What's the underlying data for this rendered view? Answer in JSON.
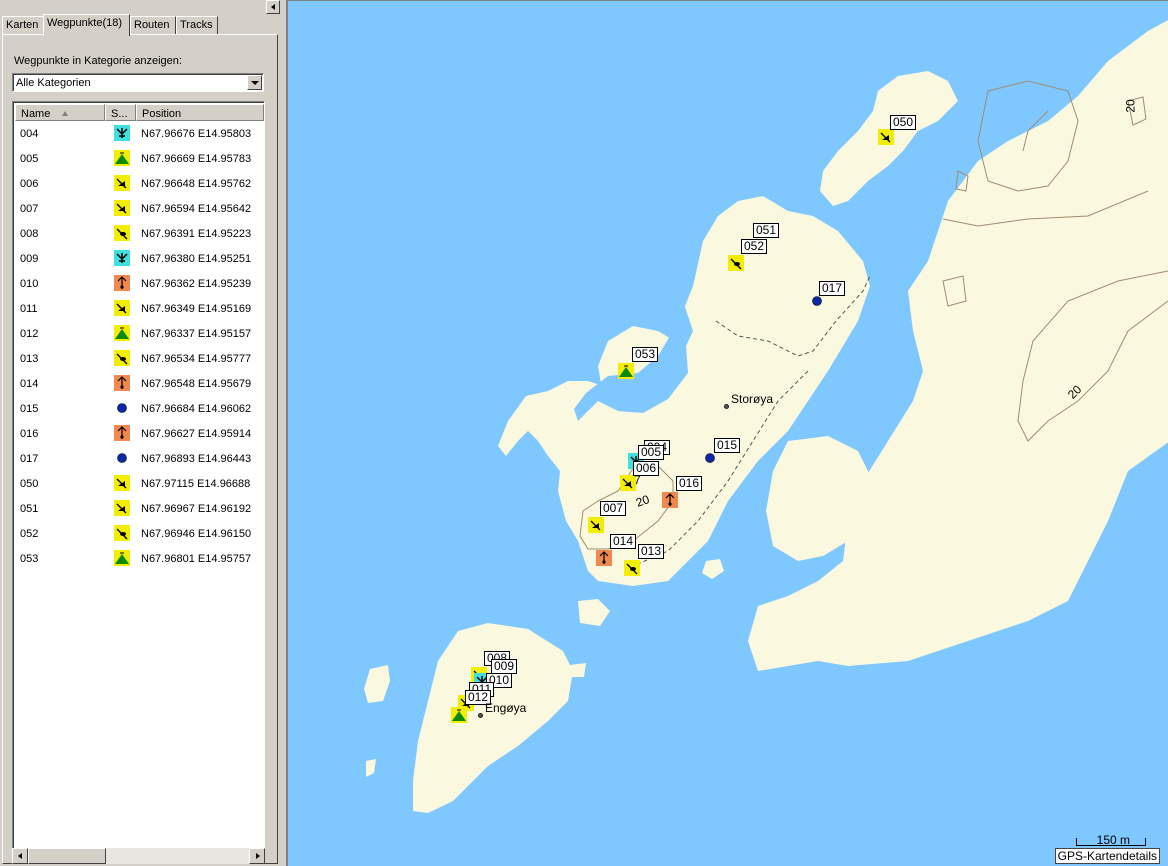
{
  "tabs": [
    "Karten",
    "Wegpunkte(18)",
    "Routen",
    "Tracks"
  ],
  "category_label": "Wegpunkte in Kategorie anzeigen:",
  "category_value": "Alle Kategorien",
  "columns": {
    "name": "Name",
    "symbol": "S...",
    "position": "Position"
  },
  "waypoints": [
    {
      "name": "004",
      "symbol": "cyan-anchor-icon",
      "position": "N67.96676 E14.95803"
    },
    {
      "name": "005",
      "symbol": "green-tent-icon",
      "position": "N67.96669 E14.95783"
    },
    {
      "name": "006",
      "symbol": "yellow-boat-icon",
      "position": "N67.96648 E14.95762"
    },
    {
      "name": "007",
      "symbol": "yellow-boat-icon",
      "position": "N67.96594 E14.95642"
    },
    {
      "name": "008",
      "symbol": "yellow-fish-icon",
      "position": "N67.96391 E14.95223"
    },
    {
      "name": "009",
      "symbol": "cyan-anchor-icon",
      "position": "N67.96380 E14.95251"
    },
    {
      "name": "010",
      "symbol": "orange-marker-icon",
      "position": "N67.96362 E14.95239"
    },
    {
      "name": "011",
      "symbol": "yellow-boat-icon",
      "position": "N67.96349 E14.95169"
    },
    {
      "name": "012",
      "symbol": "green-tent-icon",
      "position": "N67.96337 E14.95157"
    },
    {
      "name": "013",
      "symbol": "yellow-fish-icon",
      "position": "N67.96534 E14.95777"
    },
    {
      "name": "014",
      "symbol": "orange-marker-icon",
      "position": "N67.96548 E14.95679"
    },
    {
      "name": "015",
      "symbol": "blue-dot-icon",
      "position": "N67.96684 E14.96062"
    },
    {
      "name": "016",
      "symbol": "orange-marker-icon",
      "position": "N67.96627 E14.95914"
    },
    {
      "name": "017",
      "symbol": "blue-dot-icon",
      "position": "N67.96893 E14.96443"
    },
    {
      "name": "050",
      "symbol": "yellow-boat-icon",
      "position": "N67.97115 E14.96688"
    },
    {
      "name": "051",
      "symbol": "yellow-boat-icon",
      "position": "N67.96967 E14.96192"
    },
    {
      "name": "052",
      "symbol": "yellow-fish-icon",
      "position": "N67.96946 E14.96150"
    },
    {
      "name": "053",
      "symbol": "green-tent-icon",
      "position": "N67.96801 E14.95757"
    }
  ],
  "map": {
    "place_names": [
      "Storøya",
      "Engøya"
    ],
    "contour_labels": [
      "20",
      "20",
      "20"
    ],
    "marker_labels": [
      "050",
      "051",
      "052",
      "017",
      "053",
      "004",
      "005",
      "006",
      "015",
      "016",
      "007",
      "014",
      "013",
      "008",
      "009",
      "010",
      "011",
      "012",
      "7"
    ],
    "scale_label": "150 m",
    "details_label": "GPS-Kartendetails",
    "colors": {
      "water": "#7fc7ff",
      "land": "#fbf8e0",
      "contour": "#a08c6e"
    }
  }
}
